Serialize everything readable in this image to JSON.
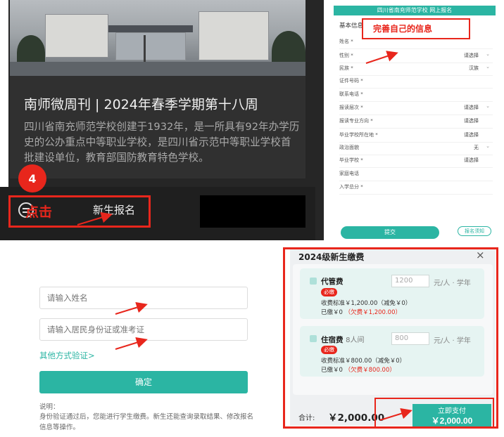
{
  "panel1": {
    "news_title": "南师微周刊 | 2024年春季学期第十八周",
    "news_body": "四川省南充师范学校创建于1932年，是一所具有92年办学历史的公办重点中等职业学校，是四川省示范中等职业学校首批建设单位，教育部国防教育特色学校。",
    "step_number": "4",
    "click_hint": "点击",
    "new_student_label": "新生报名"
  },
  "panel2": {
    "header": "四川省南充师范学校 网上报名",
    "section_title": "基本信息",
    "annotation": "完善自己的信息",
    "rows": [
      {
        "label": "姓名 *",
        "value": "",
        "chevron": ""
      },
      {
        "label": "性别 *",
        "value": "请选择",
        "chevron": "⌄"
      },
      {
        "label": "民族 *",
        "value": "汉族",
        "chevron": "⌄"
      },
      {
        "label": "证件号码 *",
        "value": "",
        "chevron": ""
      },
      {
        "label": "联系电话 *",
        "value": "",
        "chevron": ""
      },
      {
        "label": "报读层次 *",
        "value": "请选择",
        "chevron": "⌄"
      },
      {
        "label": "报读专业方向 *",
        "value": "请选择",
        "chevron": ""
      },
      {
        "label": "毕业学校所在地 *",
        "value": "请选择",
        "chevron": ""
      },
      {
        "label": "政治面貌",
        "value": "无",
        "chevron": "⌄"
      },
      {
        "label": "毕业学校 *",
        "value": "请选择",
        "chevron": ""
      },
      {
        "label": "家庭电话",
        "value": "",
        "chevron": ""
      },
      {
        "label": "入学总分 *",
        "value": "",
        "chevron": ""
      }
    ],
    "submit_label": "提交",
    "notice_label": "报名须知"
  },
  "panel3": {
    "name_placeholder": "请输入姓名",
    "id_placeholder": "请输入居民身份证或准考证",
    "other_method_link": "其他方式验证>",
    "confirm_label": "确定",
    "note_title": "说明：",
    "note_body": "身份验证通过后，您能进行学生缴费。新生还能查询录取结果、修改报名信息等操作。"
  },
  "panel4": {
    "title": "2024级新生缴费",
    "close_symbol": "×",
    "fees": [
      {
        "name": "代管费",
        "sub": "",
        "amount": "1200",
        "unit": "元/人 · 学年",
        "required": "必缴",
        "standard": "收费标准￥1,200.00（减免￥0）",
        "paid": "已缴￥0",
        "owed": "（欠费￥1,200.00）"
      },
      {
        "name": "住宿费",
        "sub": "8人间",
        "amount": "800",
        "unit": "元/人 · 学年",
        "required": "必缴",
        "standard": "收费标准￥800.00（减免￥0）",
        "paid": "已缴￥0",
        "owed": "（欠费￥800.00）"
      }
    ],
    "total_label": "合计:",
    "total_value": "￥2,000.00",
    "pay_label": "立即支付",
    "pay_amount": "￥2,000.00"
  },
  "colors": {
    "teal": "#2bb5a3",
    "annotation_red": "#e8261c",
    "dark_bg": "#262626"
  }
}
